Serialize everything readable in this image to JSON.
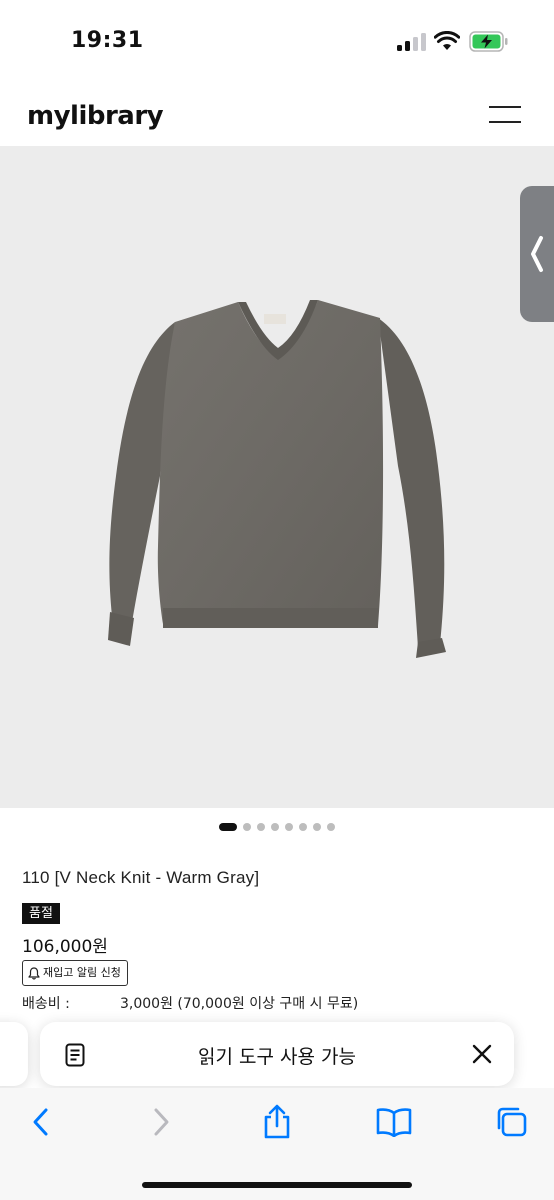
{
  "status": {
    "time": "19:31"
  },
  "header": {
    "logo": "mylibrary",
    "menu_icon": "hamburger-menu-icon"
  },
  "hero": {
    "image_alt": "gray v-neck knit sweater",
    "side_tab_icon": "chevron-left-icon"
  },
  "carousel": {
    "total": 8,
    "active_index": 0
  },
  "product": {
    "name": "110 [V Neck Knit - Warm Gray]",
    "status_badge": "품절",
    "price": "106,000원",
    "restock_label": "재입고 알림 신청",
    "shipping_label": "배송비 :",
    "shipping_value": "3,000원 (70,000원 이상 구매 시 무료)"
  },
  "reader_banner": {
    "text": "읽기 도구 사용 가능",
    "icon": "reader-page-icon",
    "close_icon": "close-icon"
  },
  "toolbar": {
    "items": [
      "back-icon",
      "forward-icon",
      "share-icon",
      "bookmarks-icon",
      "tabs-icon"
    ]
  },
  "colors": {
    "accent": "#007aff",
    "battery": "#34c759",
    "hero_bg": "#ececec",
    "sweater": "#6e6b66"
  }
}
